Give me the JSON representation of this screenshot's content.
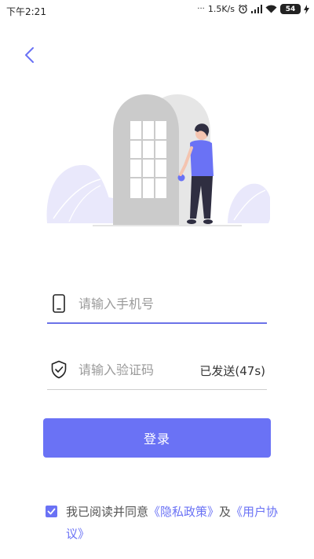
{
  "status_bar": {
    "time": "下午2:21",
    "net_speed": "1.5K/s",
    "battery": "54"
  },
  "login": {
    "phone_placeholder": "请输入手机号",
    "code_placeholder": "请输入验证码",
    "countdown": "已发送(47s)",
    "login_button": "登录"
  },
  "agreement": {
    "text_prefix": "我已阅读并同意",
    "privacy_link": "《隐私政策》",
    "conjunction": "及",
    "user_link": "《用户协议》",
    "checked": true
  },
  "colors": {
    "accent": "#6a72f5",
    "underline_active": "#6b73e8"
  },
  "icons": {
    "back": "chevron-left-icon",
    "phone": "phone-icon",
    "code": "shield-check-icon",
    "check": "check-icon"
  }
}
